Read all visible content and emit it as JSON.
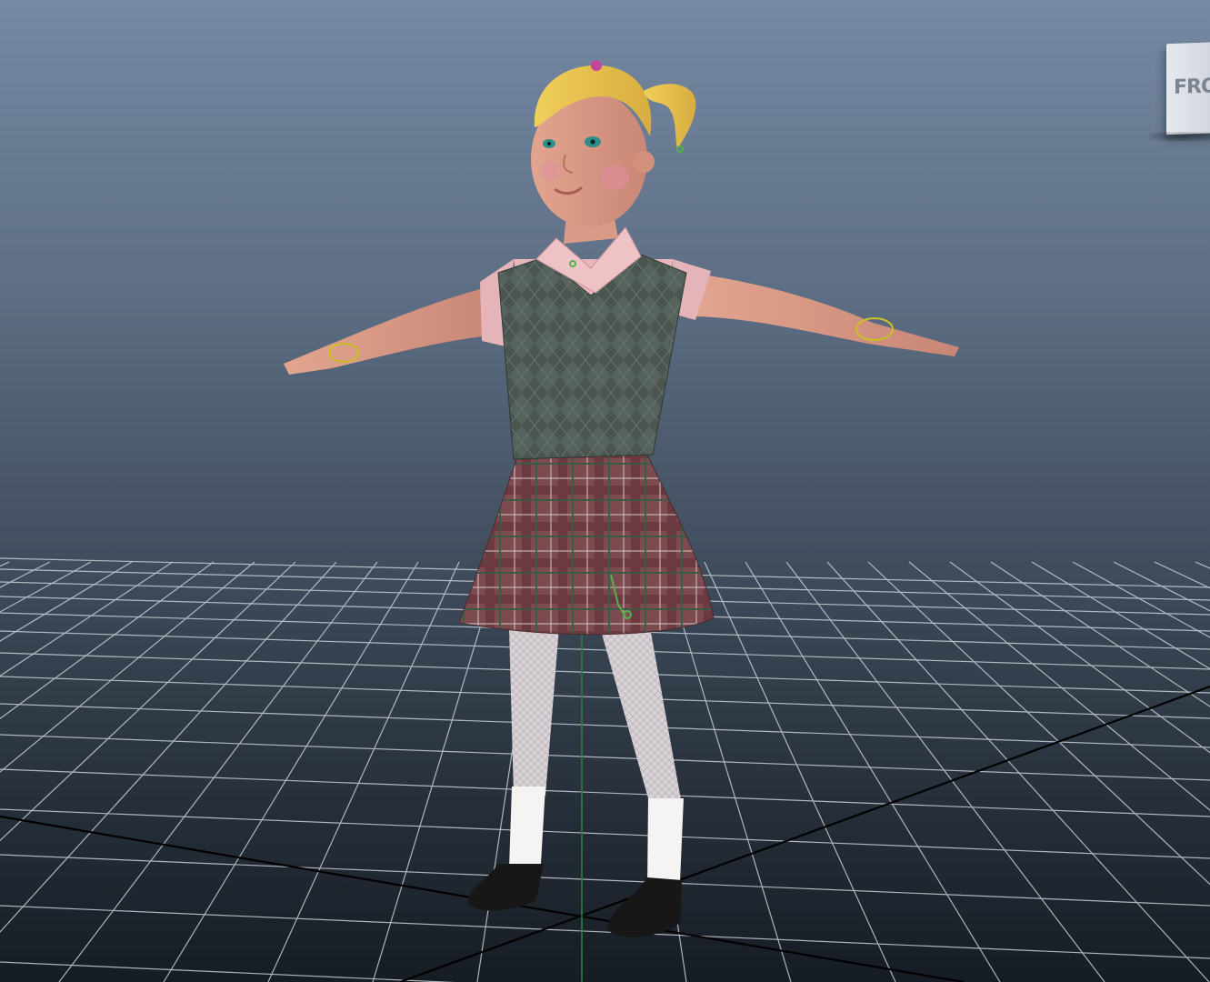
{
  "viewport": {
    "viewcube": {
      "face_label": "FRON"
    },
    "colors": {
      "grid": "#c9ced6",
      "axis_x": "#000000",
      "axis_y": "#1f7a3a",
      "handles": "#c9c21f"
    },
    "icons": {
      "character": "character-model-icon",
      "handle": "control-handle-icon"
    }
  }
}
